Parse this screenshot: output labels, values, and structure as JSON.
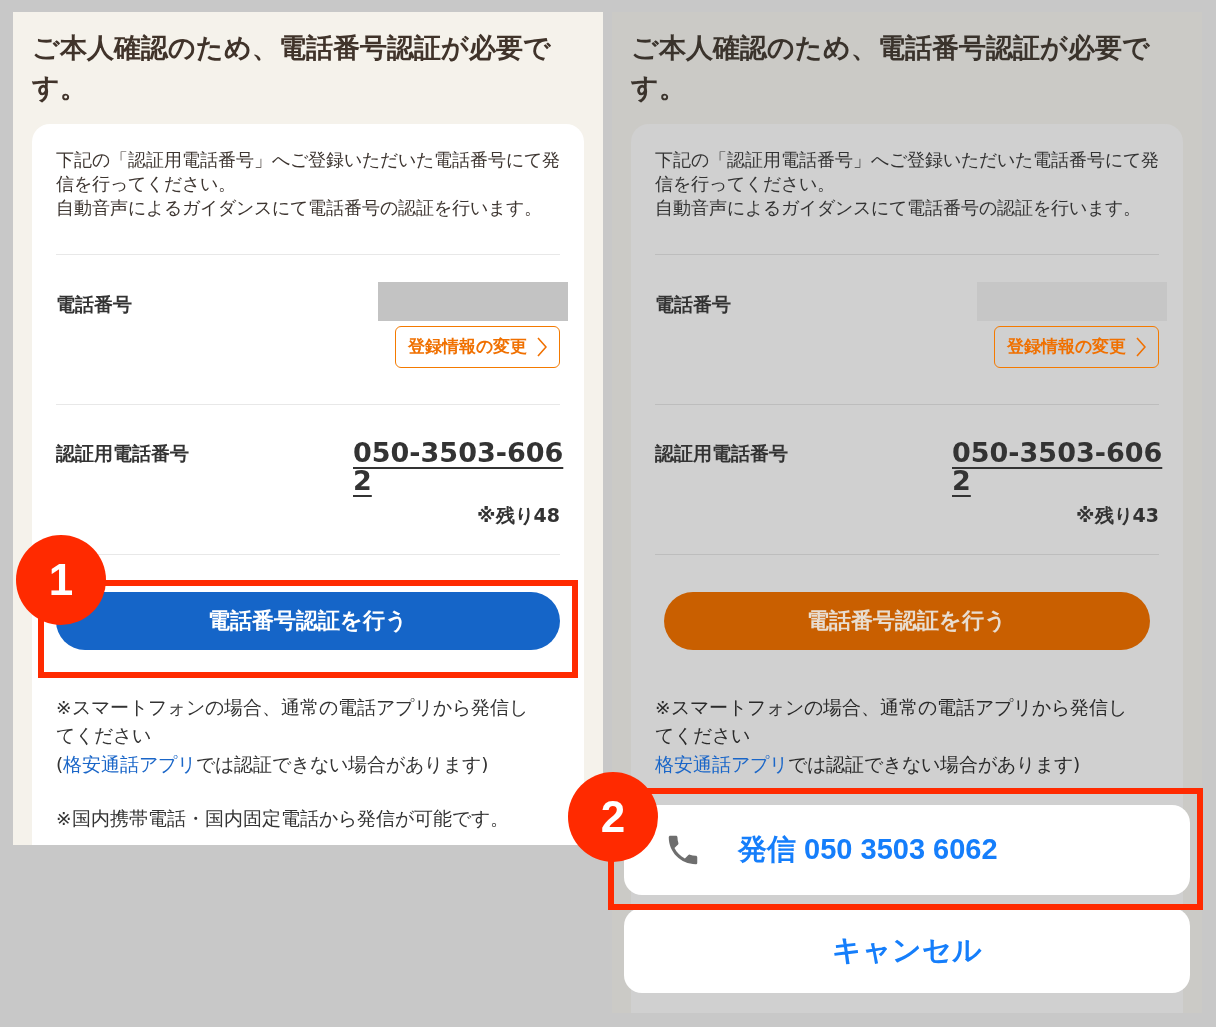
{
  "panels": [
    {
      "dimmed": false,
      "title": "ご本人確認のため、電話番号認証が必要です。",
      "intro": [
        "下記の「認証用電話番号」へご登録いただいた電話番号にて発信を行ってください。",
        "自動音声によるガイダンスにて電話番号の認証を行います。"
      ],
      "phone_label": "電話番号",
      "change_button": "登録情報の変更",
      "auth_label": "認証用電話番号",
      "auth_number": "050-3503-6062",
      "remaining": "※残り48",
      "verify_button": {
        "label": "電話番号認証を行う",
        "pressed": true,
        "annotation": "1"
      },
      "notes": [
        {
          "kind": "plain",
          "text": "※スマートフォンの場合、通常の電話アプリから発信してください"
        },
        {
          "kind": "link",
          "before": "(",
          "link": "格安通話アプリ",
          "after": "では認証できない場合があります)"
        },
        {
          "kind": "gap"
        },
        {
          "kind": "plain",
          "text": "※国内携帯電話・国内固定電話から発信が可能です。"
        }
      ]
    },
    {
      "dimmed": true,
      "title": "ご本人確認のため、電話番号認証が必要です。",
      "intro": [
        "下記の「認証用電話番号」へご登録いただいた電話番号にて発信を行ってください。",
        "自動音声によるガイダンスにて電話番号の認証を行います。"
      ],
      "phone_label": "電話番号",
      "change_button": "登録情報の変更",
      "auth_label": "認証用電話番号",
      "auth_number": "050-3503-6062",
      "remaining": "※残り43",
      "verify_button": {
        "label": "電話番号認証を行う",
        "pressed": false
      },
      "notes": [
        {
          "kind": "plain",
          "text": "※スマートフォンの場合、通常の電話アプリから発信してください"
        },
        {
          "kind": "link",
          "link": "格安通話アプリ",
          "after": "では認証できない場合があります)"
        }
      ],
      "action_sheet": {
        "call_button": "発信 050 3503 6062",
        "cancel_button": "キャンセル",
        "annotation": "2"
      }
    }
  ]
}
